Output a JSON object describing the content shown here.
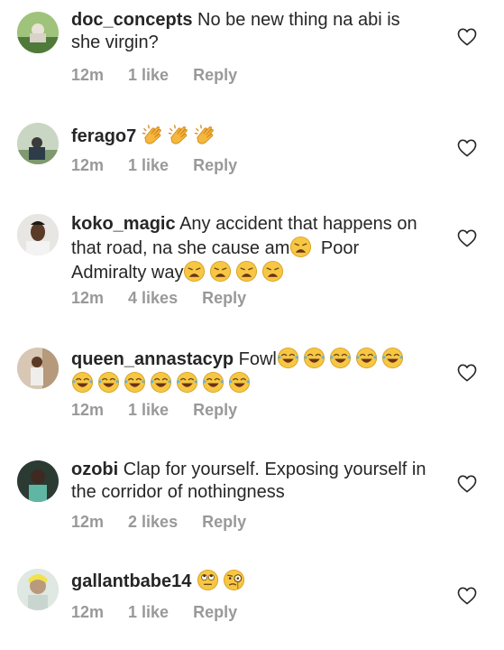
{
  "comments": [
    {
      "username": "doc_concepts",
      "text": " No be new thing na abi is she virgin?",
      "time": "12m",
      "likes": "1 like",
      "reply": "Reply",
      "avatar_color": "#6f8f5a"
    },
    {
      "username": "ferago7",
      "text": "",
      "time": "12m",
      "likes": "1 like",
      "reply": "Reply",
      "avatar_color": "#9fb3a0"
    },
    {
      "username": "koko_magic",
      "text_a": " Any accident that happens on that road, na she cause am",
      "text_b": " Poor Admiralty way",
      "time": "12m",
      "likes": "4 likes",
      "reply": "Reply",
      "avatar_color": "#c9c1b8"
    },
    {
      "username": "queen_annastacyp",
      "text": " Fowl",
      "time": "12m",
      "likes": "1 like",
      "reply": "Reply",
      "avatar_color": "#b4957a"
    },
    {
      "username": "ozobi",
      "text": " Clap for yourself. Exposing yourself in the corridor of nothingness",
      "time": "12m",
      "likes": "2 likes",
      "reply": "Reply",
      "avatar_color": "#2b3a33"
    },
    {
      "username": "gallantbabe14",
      "text": "",
      "time": "12m",
      "likes": "1 like",
      "reply": "Reply",
      "avatar_color": "#c8d5cf"
    }
  ],
  "icons": {
    "heart": "heart-outline-icon",
    "clap": "clapping-hands-emoji",
    "weary": "weary-face-emoji",
    "joy": "tears-of-joy-emoji",
    "eyeroll": "eye-roll-emoji",
    "monocle": "monocle-face-emoji"
  }
}
